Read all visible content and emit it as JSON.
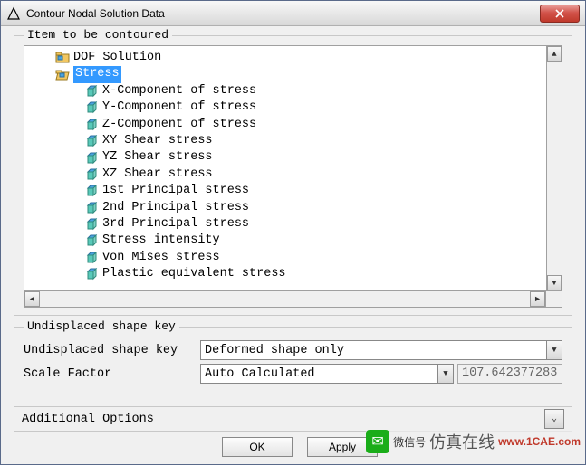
{
  "window": {
    "title": "Contour Nodal Solution Data"
  },
  "groupbox1": {
    "title": "Item to be contoured",
    "tree": {
      "nodes": {
        "dof": "DOF Solution",
        "stress": "Stress"
      },
      "stress_children": {
        "x": "X-Component of stress",
        "y": "Y-Component of stress",
        "z": "Z-Component of stress",
        "xy": "XY Shear stress",
        "yz": "YZ Shear stress",
        "xz": "XZ Shear stress",
        "p1": "1st Principal stress",
        "p2": "2nd Principal stress",
        "p3": "3rd Principal stress",
        "si": "Stress intensity",
        "vm": "von Mises stress",
        "pe": "Plastic equivalent stress"
      }
    }
  },
  "groupbox2": {
    "title": "Undisplaced shape key",
    "row1_label": "Undisplaced shape key",
    "row1_value": "Deformed shape only",
    "row2_label": "Scale Factor",
    "row2_value": "Auto Calculated",
    "row2_readonly": "107.642377283"
  },
  "additional": {
    "label": "Additional Options"
  },
  "buttons": {
    "ok": "OK",
    "apply": "Apply"
  },
  "watermark": {
    "wx_label": "微信号",
    "brand": "仿真在线",
    "url": "www.1CAE.com"
  }
}
